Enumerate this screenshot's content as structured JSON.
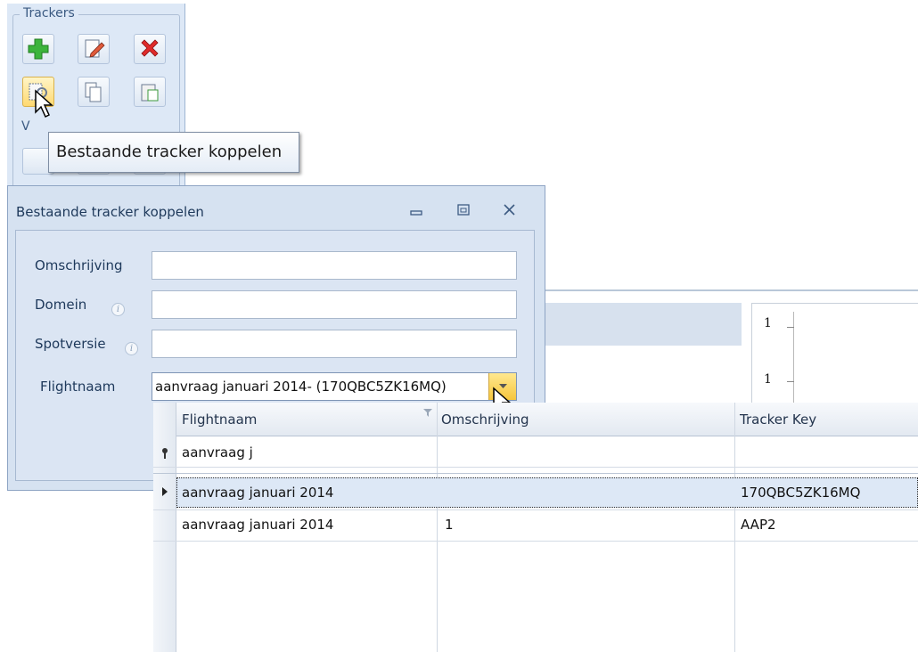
{
  "ribbon": {
    "group_title": "Trackers",
    "group2_title": "V",
    "buttons": [
      {
        "name": "add-tracker",
        "icon": "green-plus-icon"
      },
      {
        "name": "edit-tracker",
        "icon": "edit-document-icon"
      },
      {
        "name": "delete-tracker",
        "icon": "red-x-icon"
      },
      {
        "name": "link-existing-tracker",
        "icon": "link-tracker-icon"
      },
      {
        "name": "copy-tracker",
        "icon": "copy-document-icon"
      },
      {
        "name": "paste-tracker",
        "icon": "paste-document-icon"
      }
    ]
  },
  "tooltip": {
    "text": "Bestaande tracker koppelen"
  },
  "dialog": {
    "title": "Bestaande tracker koppelen",
    "fields": {
      "omschrijving_label": "Omschrijving",
      "domein_label": "Domein",
      "spotversie_label": "Spotversie",
      "flightnaam_label": "Flightnaam",
      "info_glyph": "i"
    },
    "flightnaam_value": "aanvraag januari 2014- (170QBC5ZK16MQ)"
  },
  "dropdown": {
    "columns": [
      "Flightnaam",
      "Omschrijving",
      "Tracker Key"
    ],
    "filter_value": "aanvraag j",
    "rows": [
      {
        "flightnaam": "aanvraag januari 2014",
        "omschrijving": "",
        "tracker_key": "170QBC5ZK16MQ",
        "selected": true
      },
      {
        "flightnaam": "aanvraag januari 2014",
        "omschrijving": "1",
        "tracker_key": "AAP2",
        "selected": false
      }
    ]
  },
  "background_chart": {
    "tick_labels": [
      "1",
      "1"
    ]
  },
  "colors": {
    "accent": "#f6c63d",
    "selection": "#dde8f6",
    "chrome": "#d6e2f1"
  }
}
